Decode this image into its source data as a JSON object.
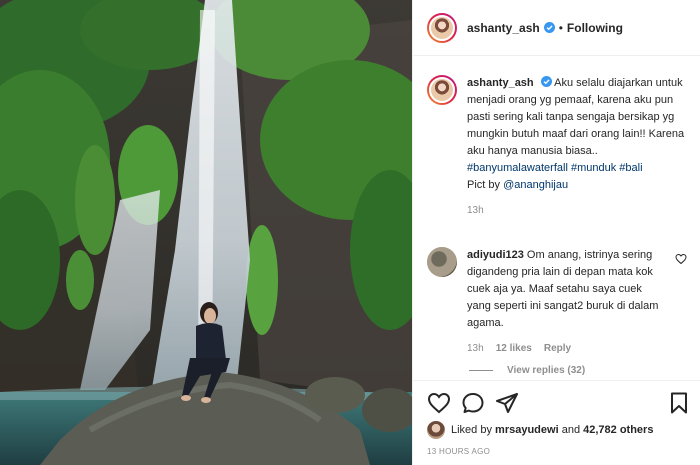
{
  "header": {
    "username": "ashanty_ash",
    "dot": "•",
    "follow_status": "Following"
  },
  "caption": {
    "username": "ashanty_ash",
    "text": "Aku selalu diajarkan untuk menjadi orang yg pemaaf, karena aku pun pasti sering kali tanpa sengaja bersikap yg mungkin butuh maaf dari orang lain!! Karena aku hanya manusia biasa..",
    "hashtags": [
      "#banyumalawaterfall",
      "#munduk",
      "#bali"
    ],
    "credit_prefix": "Pict by",
    "credit_mention": "@ananghijau",
    "time": "13h"
  },
  "comment": {
    "username": "adiyudi123",
    "text": "Om anang, istrinya sering digandeng pria lain di depan mata kok cuek aja ya. Maaf setahu saya cuek yang seperti ini sangat2 buruk di dalam agama.",
    "time": "13h",
    "likes": "12 likes",
    "reply_label": "Reply",
    "view_replies": "View replies (32)"
  },
  "likes_row": {
    "prefix": "Liked by",
    "user": "mrsayudewi",
    "middle": "and",
    "others": "42,782 others"
  },
  "timestamp": "13 HOURS AGO",
  "colors": {
    "link": "#00376b",
    "muted": "#8e8e8e",
    "verified": "#3897f0",
    "story_ring": "#dc2743"
  },
  "icons": [
    "verified-icon",
    "like-icon",
    "comment-icon",
    "share-icon",
    "save-icon",
    "heart-small-icon"
  ]
}
